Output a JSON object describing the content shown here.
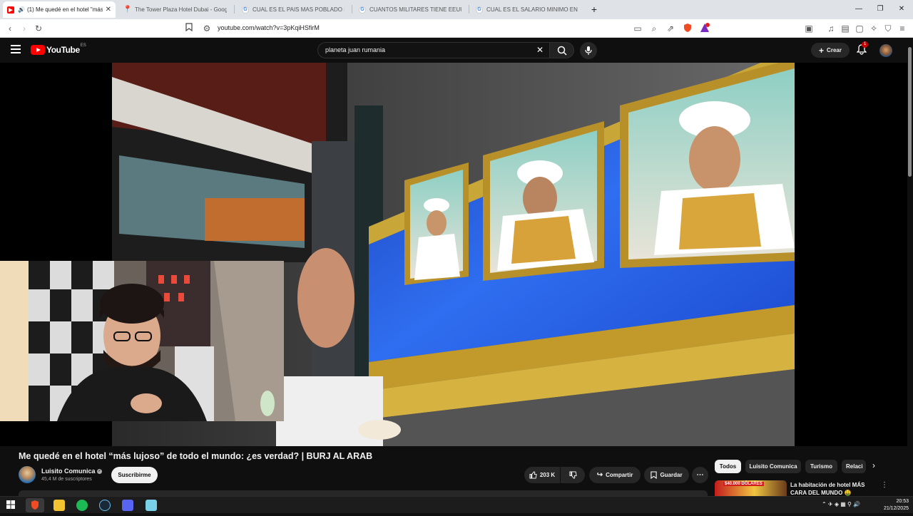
{
  "browser": {
    "tabs": [
      {
        "title": "(1) Me quedé en el hotel \"más",
        "active": true,
        "icon": "youtube-favicon",
        "color": "#ff0000"
      },
      {
        "title": "The Tower Plaza Hotel Dubai - Goog",
        "active": false,
        "icon": "google-maps-favicon",
        "color": "#34a853"
      },
      {
        "title": "CUAL ES EL PAIS MAS POBLADO DE",
        "active": false,
        "icon": "google-favicon",
        "color": "#4285f4"
      },
      {
        "title": "CUANTOS MILITARES TIENE EEUU - B",
        "active": false,
        "icon": "google-favicon",
        "color": "#4285f4"
      },
      {
        "title": "CUAL ES EL SALARIO MINIMO EN BI",
        "active": false,
        "icon": "google-favicon",
        "color": "#4285f4"
      }
    ],
    "new_tab": "+",
    "url": "youtube.com/watch?v=3pKqiHSfirM",
    "shield_badge": "1"
  },
  "youtube": {
    "logo_word": "YouTube",
    "region": "ES",
    "search_query": "planeta juan rumania",
    "create_label": "Crear",
    "notif_count": "1"
  },
  "video": {
    "title": "Me quedé en el hotel “más lujoso” de todo el mundo: ¿es verdad? | BURJ AL ARAB",
    "channel": "Luisito Comunica",
    "subscribers": "45,4 M de suscriptores",
    "subscribe_label": "Suscribirme",
    "likes": "203 K",
    "share_label": "Compartir",
    "save_label": "Guardar",
    "more_label": "⋯"
  },
  "sidebar": {
    "chips": [
      "Todos",
      "Luisito Comunica",
      "Turismo",
      "Relaci"
    ],
    "rec_title": "La habitación de hotel MÁS CARA DEL MUNDO 🤑",
    "rec_thumb_text": "$40.000 DÓLARES"
  },
  "taskbar": {
    "time": "20:53",
    "date": "21/12/2025"
  }
}
